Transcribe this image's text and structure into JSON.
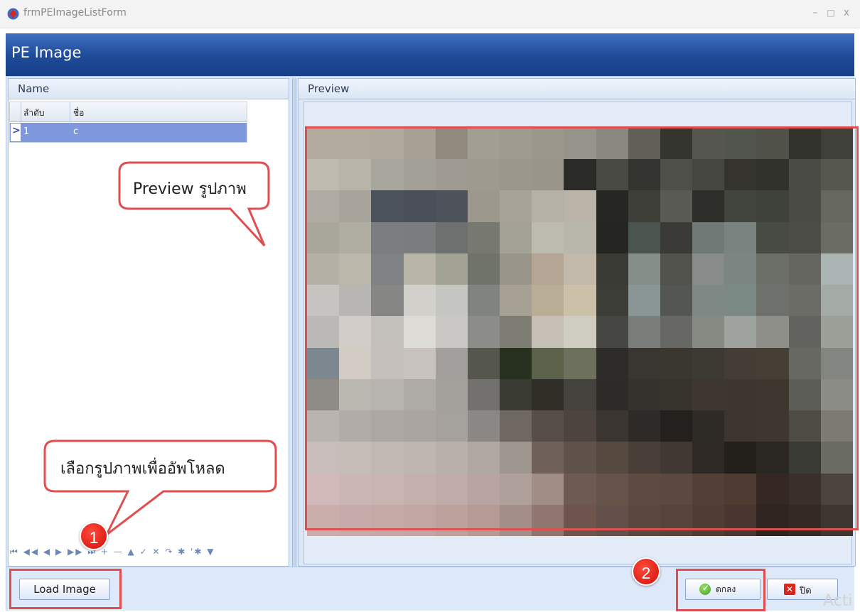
{
  "window": {
    "title": "frmPEImageListForm",
    "controls": [
      "–",
      "□",
      "x"
    ]
  },
  "header": {
    "title": "PE Image"
  },
  "left_panel": {
    "title": "Name",
    "grid": {
      "columns": [
        "ลำดับ",
        "ชื่อ"
      ],
      "rows": [
        {
          "indicator": ">",
          "no": "1",
          "name": "c",
          "selected": true
        }
      ]
    },
    "navigator": "⏮ ◀◀ ◀ ▶ ▶▶ ⏭ + — ▲ ✓ ✕ ↷ ✱ '✱ ▼"
  },
  "right_panel": {
    "title": "Preview",
    "image_description_icon": "blurred-photo"
  },
  "buttons": {
    "load_image": "Load Image",
    "ok": "ตกลง",
    "close": "ปิด"
  },
  "annotations": {
    "callout_preview": "Preview รูปภาพ",
    "callout_upload": "เลือกรูปภาพเพื่ออัพโหลด",
    "badge_1": "1",
    "badge_2": "2"
  },
  "watermark": "Acti",
  "colors": {
    "banner": "#1e4a98",
    "selected_row": "#7f97dc",
    "annotation_red": "#e04f4f"
  }
}
